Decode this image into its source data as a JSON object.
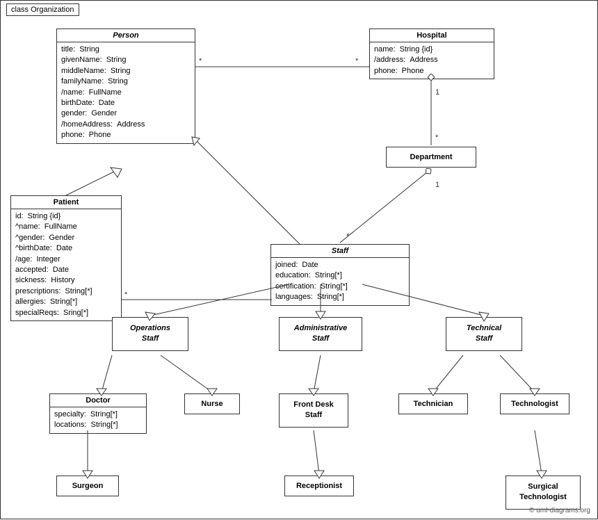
{
  "title": "class Organization",
  "copyright": "© uml-diagrams.org",
  "boxes": {
    "person": {
      "title": "Person",
      "italic": true,
      "attrs": [
        {
          "name": "title:",
          "type": "String"
        },
        {
          "name": "givenName:",
          "type": "String"
        },
        {
          "name": "middleName:",
          "type": "String"
        },
        {
          "name": "familyName:",
          "type": "String"
        },
        {
          "name": "/name:",
          "type": "FullName"
        },
        {
          "name": "birthDate:",
          "type": "Date"
        },
        {
          "name": "gender:",
          "type": "Gender"
        },
        {
          "name": "/homeAddress:",
          "type": "Address"
        },
        {
          "name": "phone:",
          "type": "Phone"
        }
      ]
    },
    "hospital": {
      "title": "Hospital",
      "italic": false,
      "attrs": [
        {
          "name": "name:",
          "type": "String {id}"
        },
        {
          "name": "/address:",
          "type": "Address"
        },
        {
          "name": "phone:",
          "type": "Phone"
        }
      ]
    },
    "department": {
      "title": "Department",
      "italic": false,
      "attrs": []
    },
    "patient": {
      "title": "Patient",
      "italic": false,
      "attrs": [
        {
          "name": "id:",
          "type": "String {id}"
        },
        {
          "name": "^name:",
          "type": "FullName"
        },
        {
          "name": "^gender:",
          "type": "Gender"
        },
        {
          "name": "^birthDate:",
          "type": "Date"
        },
        {
          "name": "/age:",
          "type": "Integer"
        },
        {
          "name": "accepted:",
          "type": "Date"
        },
        {
          "name": "sickness:",
          "type": "History"
        },
        {
          "name": "prescriptions:",
          "type": "String[*]"
        },
        {
          "name": "allergies:",
          "type": "String[*]"
        },
        {
          "name": "specialReqs:",
          "type": "Sring[*]"
        }
      ]
    },
    "staff": {
      "title": "Staff",
      "italic": true,
      "attrs": [
        {
          "name": "joined:",
          "type": "Date"
        },
        {
          "name": "education:",
          "type": "String[*]"
        },
        {
          "name": "certification:",
          "type": "String[*]"
        },
        {
          "name": "languages:",
          "type": "String[*]"
        }
      ]
    },
    "operations_staff": {
      "title": "Operations\nStaff",
      "italic": true,
      "attrs": []
    },
    "administrative_staff": {
      "title": "Administrative\nStaff",
      "italic": true,
      "attrs": []
    },
    "technical_staff": {
      "title": "Technical\nStaff",
      "italic": true,
      "attrs": []
    },
    "doctor": {
      "title": "Doctor",
      "italic": false,
      "attrs": [
        {
          "name": "specialty:",
          "type": "String[*]"
        },
        {
          "name": "locations:",
          "type": "String[*]"
        }
      ]
    },
    "nurse": {
      "title": "Nurse",
      "italic": false,
      "attrs": []
    },
    "front_desk_staff": {
      "title": "Front Desk\nStaff",
      "italic": false,
      "attrs": []
    },
    "technician": {
      "title": "Technician",
      "italic": false,
      "attrs": []
    },
    "technologist": {
      "title": "Technologist",
      "italic": false,
      "attrs": []
    },
    "surgeon": {
      "title": "Surgeon",
      "italic": false,
      "attrs": []
    },
    "receptionist": {
      "title": "Receptionist",
      "italic": false,
      "attrs": []
    },
    "surgical_technologist": {
      "title": "Surgical\nTechnologist",
      "italic": false,
      "attrs": []
    }
  }
}
